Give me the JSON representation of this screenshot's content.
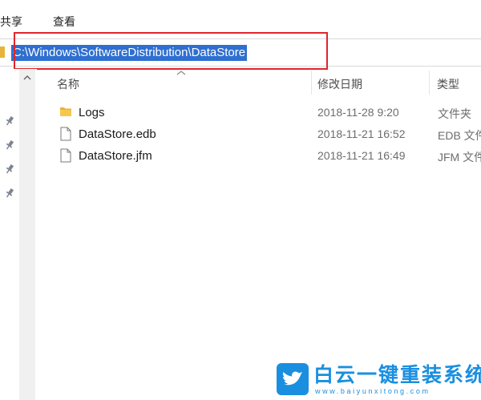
{
  "menu": {
    "items": [
      {
        "label": "共享"
      },
      {
        "label": "查看"
      }
    ]
  },
  "address_bar": {
    "path": "C:\\Windows\\SoftwareDistribution\\DataStore"
  },
  "columns": {
    "name": "名称",
    "date_modified": "修改日期",
    "type": "类型"
  },
  "files": [
    {
      "name": "Logs",
      "date": "2018-11-28 9:20",
      "type": "文件夹",
      "icon": "folder-icon"
    },
    {
      "name": "DataStore.edb",
      "date": "2018-11-21 16:52",
      "type": "EDB 文件",
      "icon": "file-icon"
    },
    {
      "name": "DataStore.jfm",
      "date": "2018-11-21 16:49",
      "type": "JFM 文件",
      "icon": "file-icon"
    }
  ],
  "watermark": {
    "title": "白云一键重装系统",
    "url": "www.baiyunxitong.com"
  },
  "colors": {
    "selection": "#2f6fd0",
    "highlight_box": "#e0252b",
    "folder": "#e8b33b",
    "brand": "#1a8fe0"
  }
}
